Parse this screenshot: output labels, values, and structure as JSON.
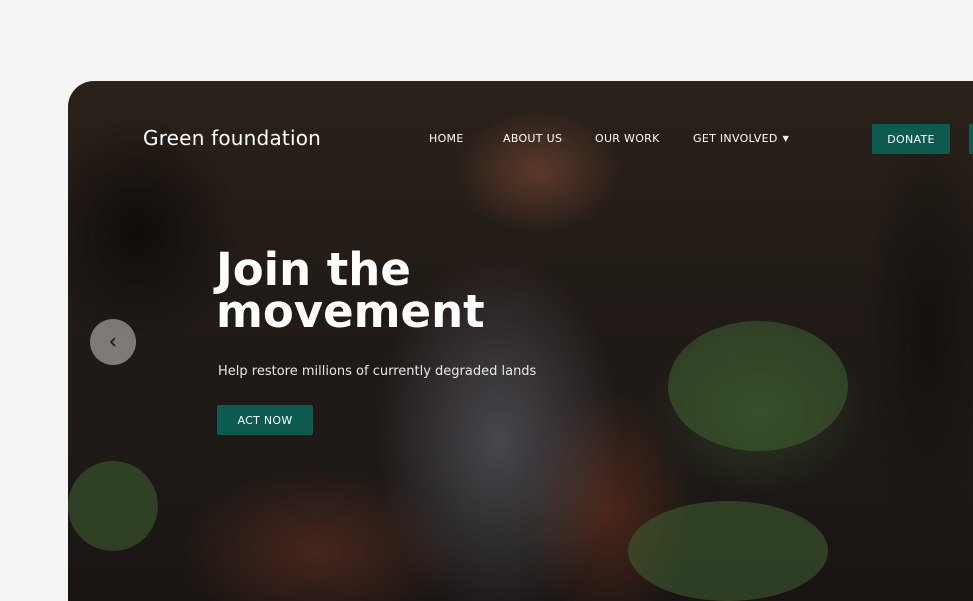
{
  "brand": {
    "name": "Green foundation"
  },
  "nav": {
    "items": [
      {
        "label": "HOME"
      },
      {
        "label": "ABOUT US"
      },
      {
        "label": "OUR WORK"
      },
      {
        "label": "GET INVOLVED"
      }
    ],
    "donate_label": "DONATE"
  },
  "hero": {
    "headline": "Join the movement",
    "subtext": "Help restore millions of currently degraded lands",
    "cta_label": "ACT NOW",
    "prev_icon": "chevron-left-icon"
  },
  "colors": {
    "accent": "#0d5b4f",
    "page_background": "#f4f4f4",
    "text_on_image": "#ffffff"
  }
}
